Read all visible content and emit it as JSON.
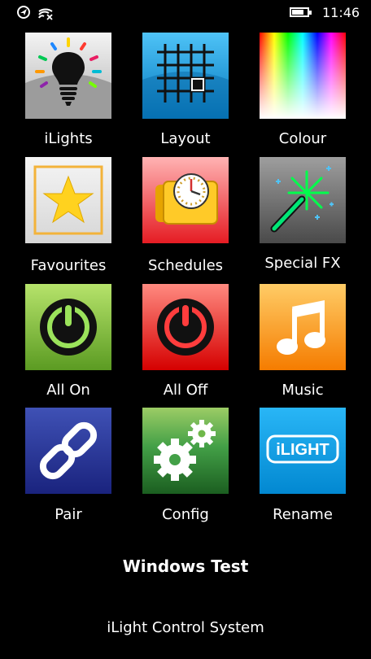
{
  "status_bar": {
    "time": "11:46",
    "battery_level": 0.75
  },
  "tiles": [
    {
      "label": "iLights",
      "icon": "lightbulb-icon"
    },
    {
      "label": "Layout",
      "icon": "grid-layout-icon"
    },
    {
      "label": "Colour",
      "icon": "colour-spectrum-icon"
    },
    {
      "label": "Favourites",
      "icon": "star-icon"
    },
    {
      "label": "Schedules",
      "icon": "clock-icon"
    },
    {
      "label": "Special FX",
      "icon": "magic-wand-icon"
    },
    {
      "label": "All On",
      "icon": "power-on-icon"
    },
    {
      "label": "All Off",
      "icon": "power-off-icon"
    },
    {
      "label": "Music",
      "icon": "music-note-icon"
    },
    {
      "label": "Pair",
      "icon": "link-icon"
    },
    {
      "label": "Config",
      "icon": "gears-icon"
    },
    {
      "label": "Rename",
      "icon": "ilight-logo"
    }
  ],
  "logo_text": "iLIGHT",
  "device_name": "Windows Test",
  "footer_text": "iLight Control System"
}
